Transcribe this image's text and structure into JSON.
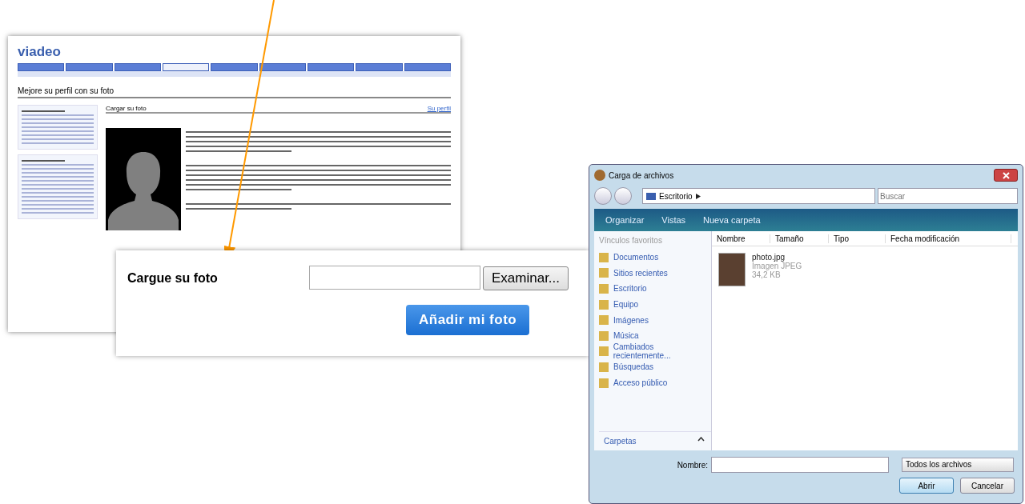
{
  "web_page": {
    "logo": "viadeo",
    "nav_tabs": [
      {
        "selected": false
      },
      {
        "selected": false
      },
      {
        "selected": false
      },
      {
        "selected": true
      },
      {
        "selected": false
      },
      {
        "selected": false
      },
      {
        "selected": false
      },
      {
        "selected": false
      },
      {
        "selected": false
      }
    ],
    "page_title": "Mejore su perfil con su foto",
    "section_title": "Cargar su foto",
    "profile_link": "Su perfil"
  },
  "upload_form": {
    "label": "Cargue su foto",
    "browse_button": "Examinar...",
    "submit_button": "Añadir mi foto"
  },
  "file_dialog": {
    "title": "Carga de archivos",
    "location": "Escritorio",
    "search": {
      "placeholder": "Buscar"
    },
    "toolbar": [
      "Organizar",
      "Vistas",
      "Nueva carpeta"
    ],
    "favorites_heading": "Vínculos favoritos",
    "favorites": [
      "Documentos",
      "Sitios recientes",
      "Escritorio",
      "Equipo",
      "Imágenes",
      "Música",
      "Cambiados recientemente...",
      "Búsquedas",
      "Acceso público"
    ],
    "folders_label": "Carpetas",
    "columns": [
      "Nombre",
      "Tamaño",
      "Tipo",
      "Fecha modificación"
    ],
    "files": [
      {
        "name": "photo.jpg",
        "type": "Imagen JPEG",
        "size": "34,2 KB"
      }
    ],
    "filename_label": "Nombre:",
    "filter": "Todos los archivos",
    "open_button": "Abrir",
    "cancel_button": "Cancelar"
  }
}
